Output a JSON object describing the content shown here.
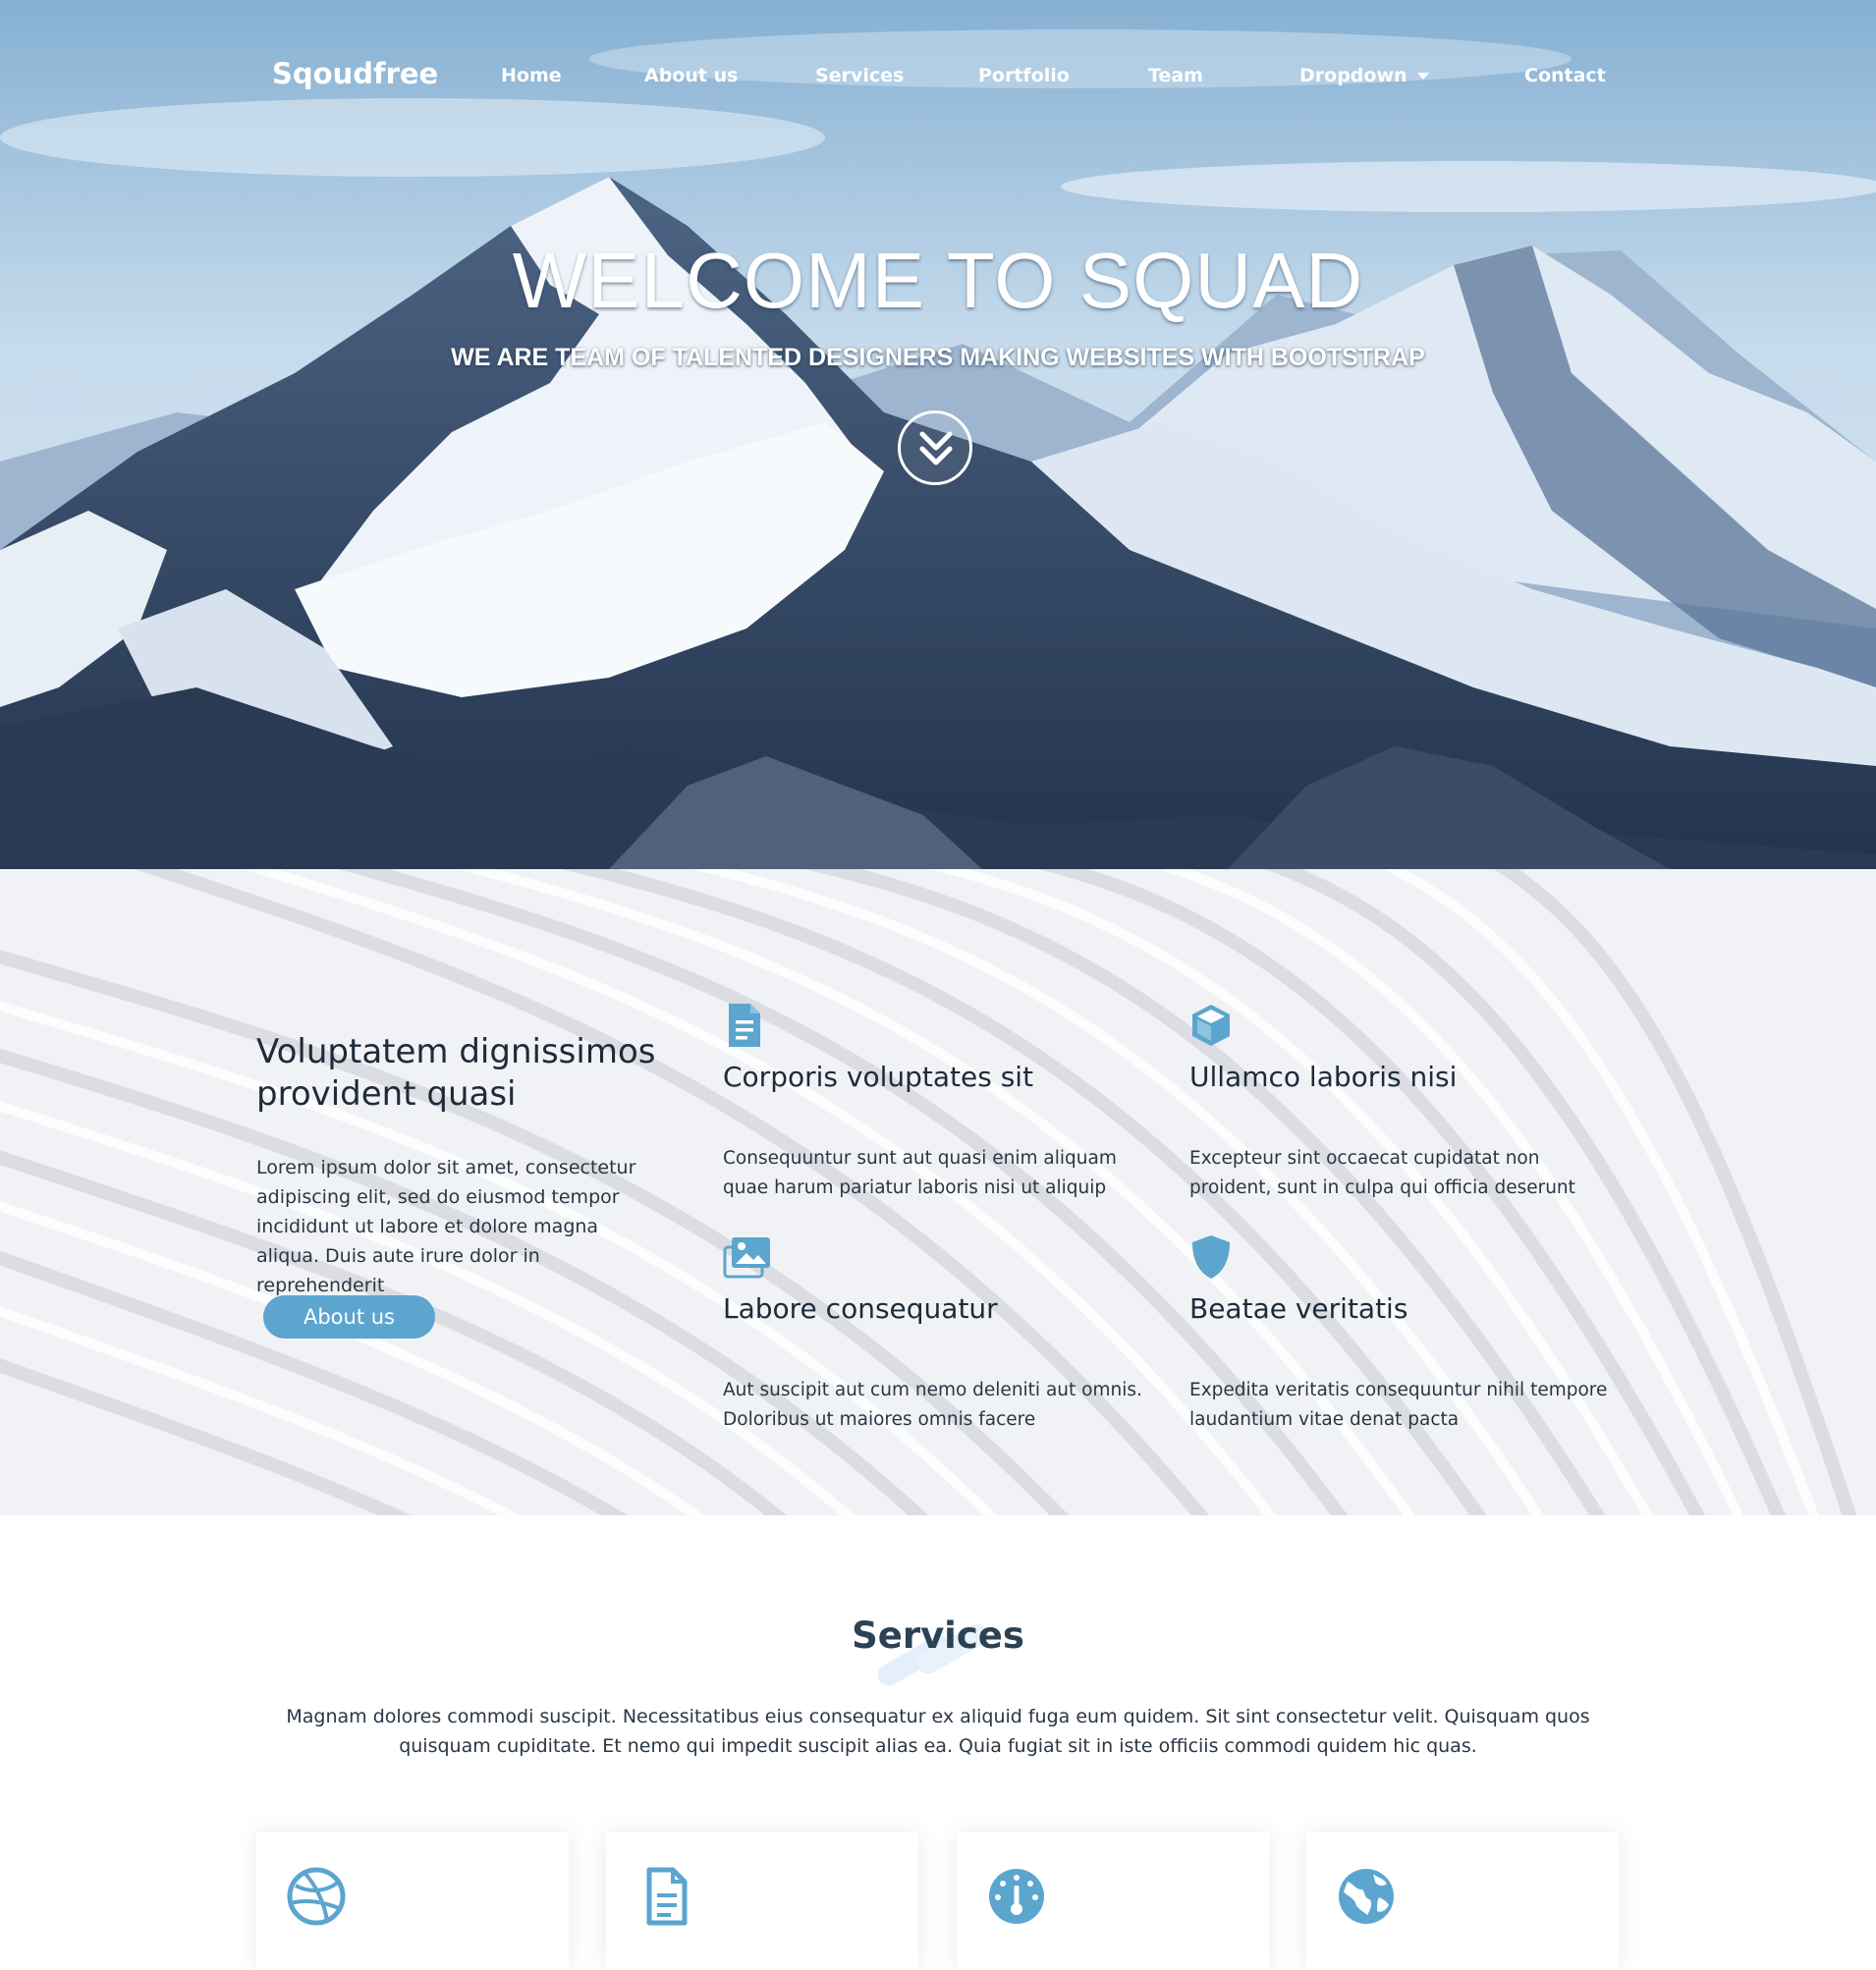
{
  "navbar": {
    "brand": "Sqoudfree",
    "links": [
      {
        "label": "Home"
      },
      {
        "label": "About us"
      },
      {
        "label": "Services"
      },
      {
        "label": "Portfolio"
      },
      {
        "label": "Team"
      },
      {
        "label": "Dropdown",
        "icon": "caret-down-icon"
      },
      {
        "label": "Contact"
      }
    ]
  },
  "hero": {
    "title": "WELCOME TO SQUAD",
    "subtitle": "WE ARE TEAM OF TALENTED DESIGNERS MAKING WEBSITES WITH BOOTSTRAP",
    "scroll_icon": "double-chevron-down-icon"
  },
  "about": {
    "title": "Voluptatem dignissimos provident quasi",
    "text": "Lorem ipsum dolor sit amet, consectetur adipiscing elit, sed do eiusmod tempor incididunt ut labore et dolore magna aliqua. Duis aute irure dolor in reprehenderit",
    "button_label": "About us",
    "features": [
      {
        "icon": "document-icon",
        "title": "Corporis voluptates sit",
        "text": "Consequuntur sunt aut quasi enim aliquam quae harum pariatur laboris nisi ut aliquip"
      },
      {
        "icon": "cube-icon",
        "title": "Ullamco laboris nisi",
        "text": "Excepteur sint occaecat cupidatat non proident, sunt in culpa qui officia deserunt"
      },
      {
        "icon": "images-icon",
        "title": "Labore consequatur",
        "text": "Aut suscipit aut cum nemo deleniti aut omnis. Doloribus ut maiores omnis facere"
      },
      {
        "icon": "shield-icon",
        "title": "Beatae veritatis",
        "text": "Expedita veritatis consequuntur nihil tempore laudantium vitae denat pacta"
      }
    ]
  },
  "services": {
    "title": "Services",
    "text": "Magnam dolores commodi suscipit. Necessitatibus eius consequatur ex aliquid fuga eum quidem. Sit sint consectetur velit. Quisquam quos quisquam cupiditate. Et nemo qui impedit suscipit alias ea. Quia fugiat sit in iste officiis commodi quidem hic quas.",
    "cards": [
      {
        "icon": "dribbble-icon"
      },
      {
        "icon": "file-text-icon"
      },
      {
        "icon": "speedometer-icon"
      },
      {
        "icon": "globe-icon"
      }
    ]
  },
  "colors": {
    "accent": "#5ba5cf",
    "heading": "#1d2b3a",
    "services_title": "#2b4255"
  }
}
